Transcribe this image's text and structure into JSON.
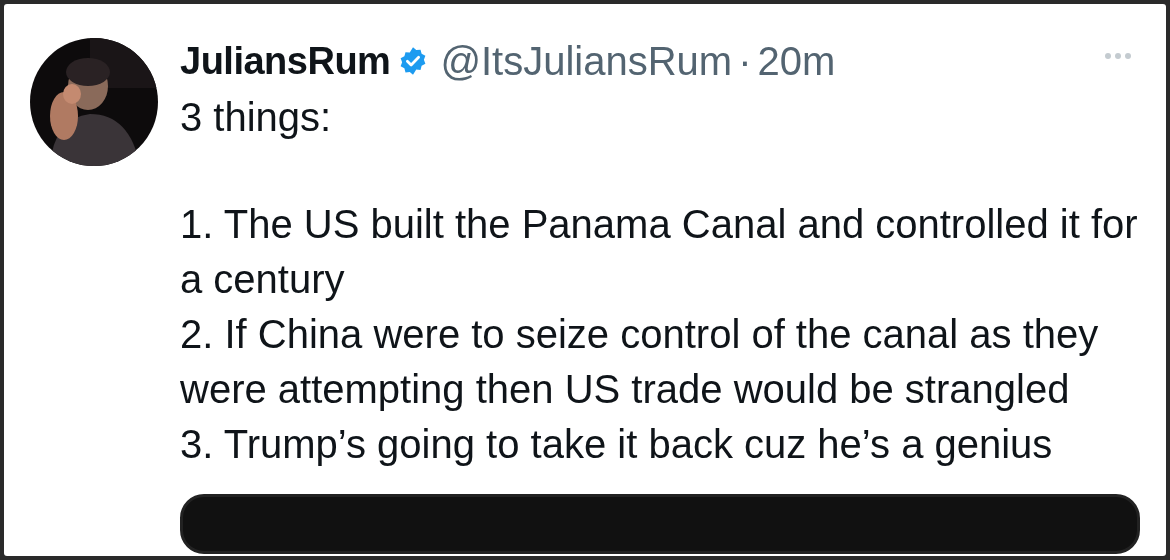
{
  "post": {
    "display_name": "JuliansRum",
    "verified": true,
    "handle": "@ItsJuliansRum",
    "separator": "·",
    "time": "20m",
    "intro": "3 things:",
    "points": [
      "1. The US built the Panama Canal and controlled it for a century",
      "2. If China were to seize control of the canal as they were attempting then US trade would be strangled",
      "3. Trump’s going to take it back cuz he’s a genius"
    ],
    "attachment": {
      "kind": "card"
    }
  }
}
